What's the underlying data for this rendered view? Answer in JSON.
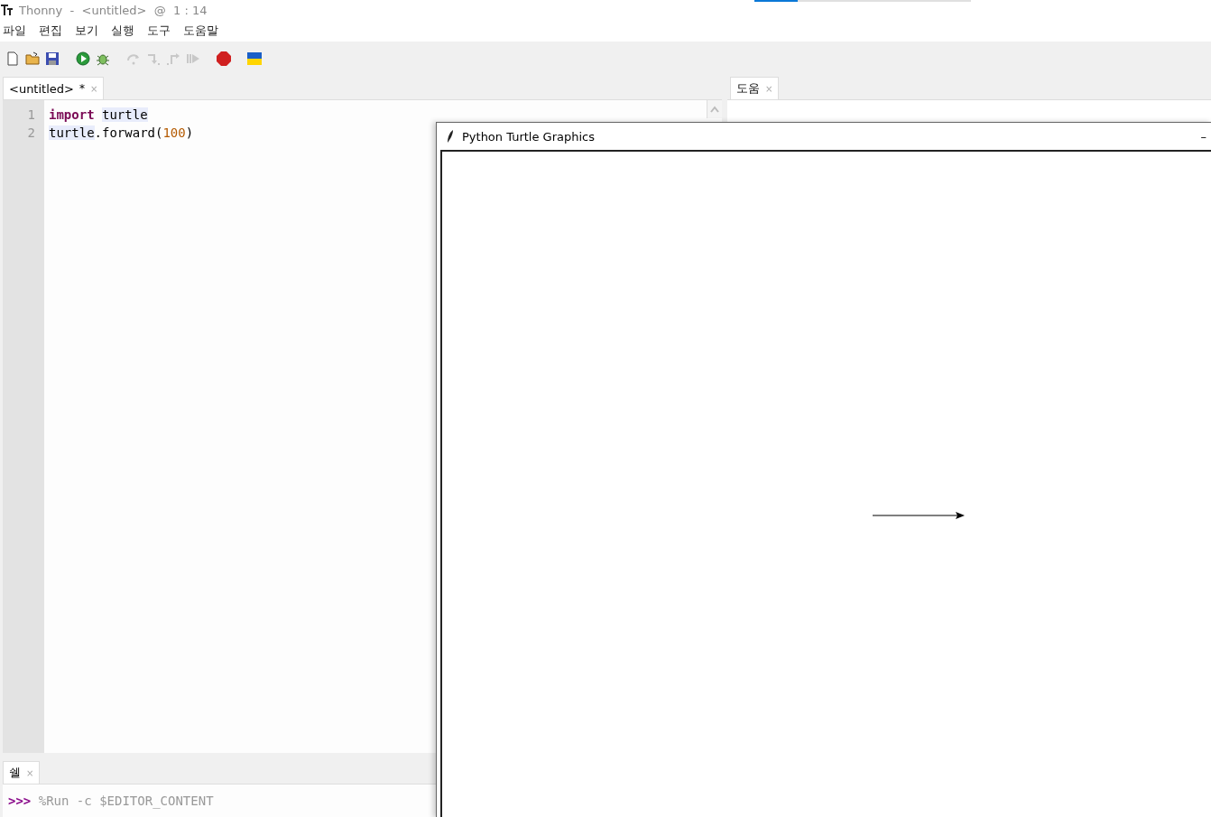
{
  "window": {
    "title": "Thonny  -  <untitled>  @  1 : 14"
  },
  "top_progress": {
    "level": 0.2
  },
  "menu": [
    "파일",
    "편집",
    "보기",
    "실행",
    "도구",
    "도움말"
  ],
  "toolbar": [
    {
      "kind": "new"
    },
    {
      "kind": "open"
    },
    {
      "kind": "save"
    },
    {
      "kind": "run"
    },
    {
      "kind": "debug"
    },
    {
      "kind": "step_over",
      "disabled": true
    },
    {
      "kind": "step_into",
      "disabled": true
    },
    {
      "kind": "step_out",
      "disabled": true
    },
    {
      "kind": "resume",
      "disabled": true
    },
    {
      "kind": "stop"
    },
    {
      "kind": "flag"
    }
  ],
  "editor": {
    "tabs": [
      {
        "label": "<untitled>",
        "modified": "*",
        "close": "×",
        "selected": true
      }
    ],
    "lines": [
      {
        "number": "1",
        "tokens": [
          {
            "kind": "keyword",
            "text": "import "
          },
          {
            "kind": "highlight",
            "text": "turtle"
          }
        ]
      },
      {
        "number": "2",
        "tokens": [
          {
            "kind": "highlight",
            "text": "turtle"
          },
          {
            "kind": "plain",
            "text": ".forward("
          },
          {
            "kind": "number",
            "text": "100"
          },
          {
            "kind": "plain",
            "text": ")"
          }
        ]
      }
    ]
  },
  "help": {
    "tabs": [
      {
        "label": "도움",
        "close": "×",
        "selected": true
      }
    ]
  },
  "shell": {
    "tabs": [
      {
        "label": "쉘",
        "close": "×",
        "selected": true
      }
    ],
    "prompt": ">>>",
    "command": "%Run -c $EDITOR_CONTENT"
  },
  "turtle_window": {
    "title": "Python Turtle Graphics",
    "minimize": "–"
  }
}
